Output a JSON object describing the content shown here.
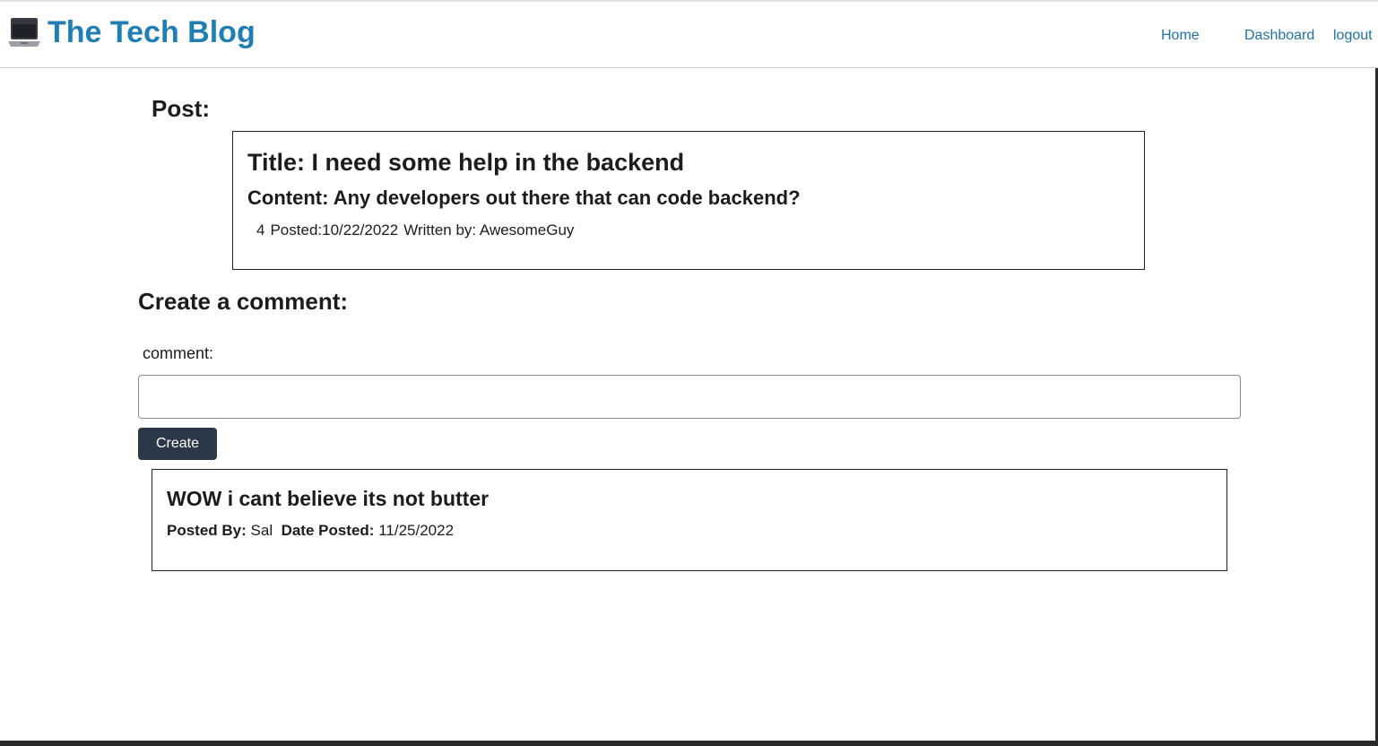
{
  "header": {
    "logo_icon": "laptop-icon",
    "title": "The Tech Blog",
    "nav": {
      "home": "Home",
      "dashboard": "Dashboard",
      "logout": "logout"
    }
  },
  "post_section": {
    "heading": "Post:",
    "post": {
      "title": "Title: I need some help in the backend",
      "content": "Content: Any developers out there that can code backend?",
      "id": "4",
      "posted": "Posted:10/22/2022",
      "author": "Written by: AwesomeGuy"
    }
  },
  "comment_form": {
    "heading": "Create a comment:",
    "label": "comment:",
    "value": "",
    "placeholder": "",
    "button_label": "Create"
  },
  "comments": [
    {
      "text": "WOW i cant believe its not butter",
      "posted_by_label": "Posted By:",
      "posted_by": "Sal",
      "date_label": "Date Posted:",
      "date": "11/25/2022"
    }
  ],
  "colors": {
    "brand": "#1f7fb4",
    "nav_link": "#1f72a8",
    "button": "#2b3848"
  }
}
